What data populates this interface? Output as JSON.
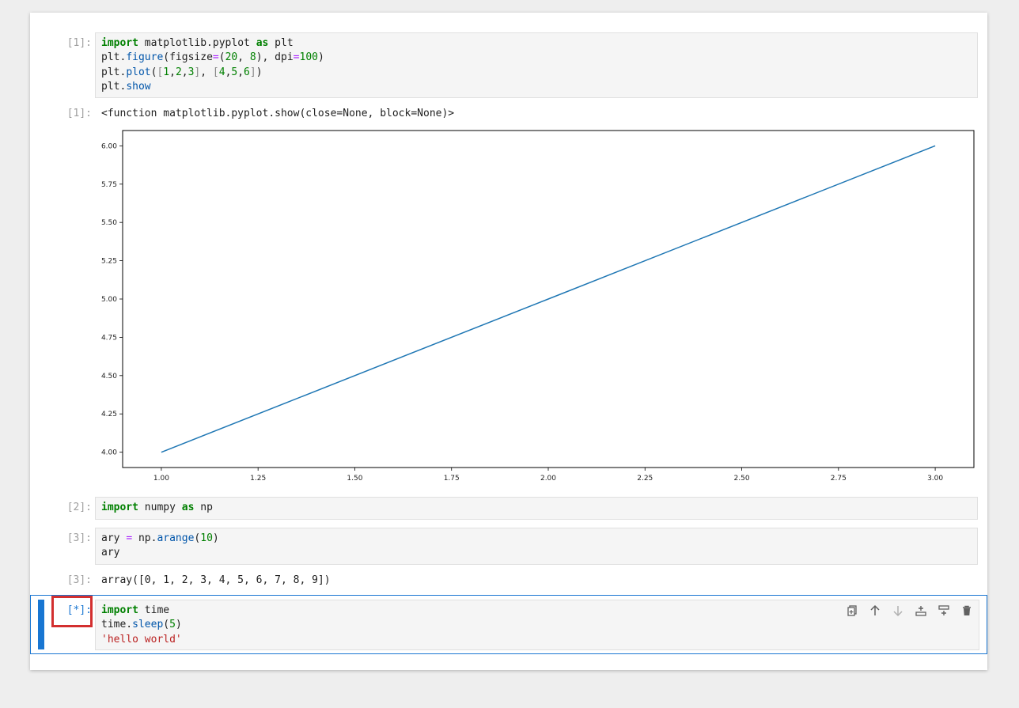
{
  "cells": {
    "c1": {
      "prompt": "[1]:",
      "lines": [
        [
          {
            "t": "import",
            "c": "kw"
          },
          {
            "t": " matplotlib.pyplot "
          },
          {
            "t": "as",
            "c": "kw"
          },
          {
            "t": " plt"
          }
        ],
        [
          {
            "t": "plt."
          },
          {
            "t": "figure",
            "c": "fn"
          },
          {
            "t": "(figsize"
          },
          {
            "t": "=",
            "c": "op"
          },
          {
            "t": "("
          },
          {
            "t": "20",
            "c": "num"
          },
          {
            "t": ", "
          },
          {
            "t": "8",
            "c": "num"
          },
          {
            "t": "), dpi"
          },
          {
            "t": "=",
            "c": "op"
          },
          {
            "t": "100",
            "c": "num"
          },
          {
            "t": ")"
          }
        ],
        [
          {
            "t": "plt."
          },
          {
            "t": "plot",
            "c": "fn"
          },
          {
            "t": "("
          },
          {
            "t": "[",
            "c": "br"
          },
          {
            "t": "1",
            "c": "num"
          },
          {
            "t": ","
          },
          {
            "t": "2",
            "c": "num"
          },
          {
            "t": ","
          },
          {
            "t": "3",
            "c": "num"
          },
          {
            "t": "]",
            "c": "br"
          },
          {
            "t": ", "
          },
          {
            "t": "[",
            "c": "br"
          },
          {
            "t": "4",
            "c": "num"
          },
          {
            "t": ","
          },
          {
            "t": "5",
            "c": "num"
          },
          {
            "t": ","
          },
          {
            "t": "6",
            "c": "num"
          },
          {
            "t": "]",
            "c": "br"
          },
          {
            "t": ")"
          }
        ],
        [
          {
            "t": "plt."
          },
          {
            "t": "show",
            "c": "fn"
          }
        ]
      ],
      "output_prompt": "[1]:",
      "output_text": "<function matplotlib.pyplot.show(close=None, block=None)>"
    },
    "c2": {
      "prompt": "[2]:",
      "lines": [
        [
          {
            "t": "import",
            "c": "kw"
          },
          {
            "t": " numpy "
          },
          {
            "t": "as",
            "c": "kw"
          },
          {
            "t": " np"
          }
        ]
      ]
    },
    "c3": {
      "prompt": "[3]:",
      "lines": [
        [
          {
            "t": "ary "
          },
          {
            "t": "=",
            "c": "op"
          },
          {
            "t": " np."
          },
          {
            "t": "arange",
            "c": "fn"
          },
          {
            "t": "("
          },
          {
            "t": "10",
            "c": "num"
          },
          {
            "t": ")"
          }
        ],
        [
          {
            "t": "ary"
          }
        ]
      ],
      "output_prompt": "[3]:",
      "output_text": "array([0, 1, 2, 3, 4, 5, 6, 7, 8, 9])"
    },
    "c4": {
      "prompt": "[*]:",
      "lines": [
        [
          {
            "t": "import",
            "c": "kw"
          },
          {
            "t": " time"
          }
        ],
        [
          {
            "t": "time."
          },
          {
            "t": "sleep",
            "c": "fn"
          },
          {
            "t": "("
          },
          {
            "t": "5",
            "c": "num"
          },
          {
            "t": ")"
          }
        ],
        [
          {
            "t": "'hello world'",
            "c": "str"
          }
        ]
      ]
    }
  },
  "cell_toolbar": {
    "icons": [
      "duplicate-icon",
      "move-up-icon",
      "move-down-icon",
      "insert-above-icon",
      "insert-below-icon",
      "delete-icon"
    ]
  },
  "colors": {
    "accent": "#1976d2",
    "highlight": "#d32f2f",
    "line": "#1f77b4"
  },
  "chart_data": {
    "type": "line",
    "x": [
      1,
      2,
      3
    ],
    "series": [
      {
        "values": [
          4,
          5,
          6
        ]
      }
    ],
    "xlim": [
      0.9,
      3.1
    ],
    "ylim": [
      3.9,
      6.1
    ],
    "xticks": [
      "1.00",
      "1.25",
      "1.50",
      "1.75",
      "2.00",
      "2.25",
      "2.50",
      "2.75",
      "3.00"
    ],
    "yticks": [
      "4.00",
      "4.25",
      "4.50",
      "4.75",
      "5.00",
      "5.25",
      "5.50",
      "5.75",
      "6.00"
    ],
    "grid": false
  }
}
